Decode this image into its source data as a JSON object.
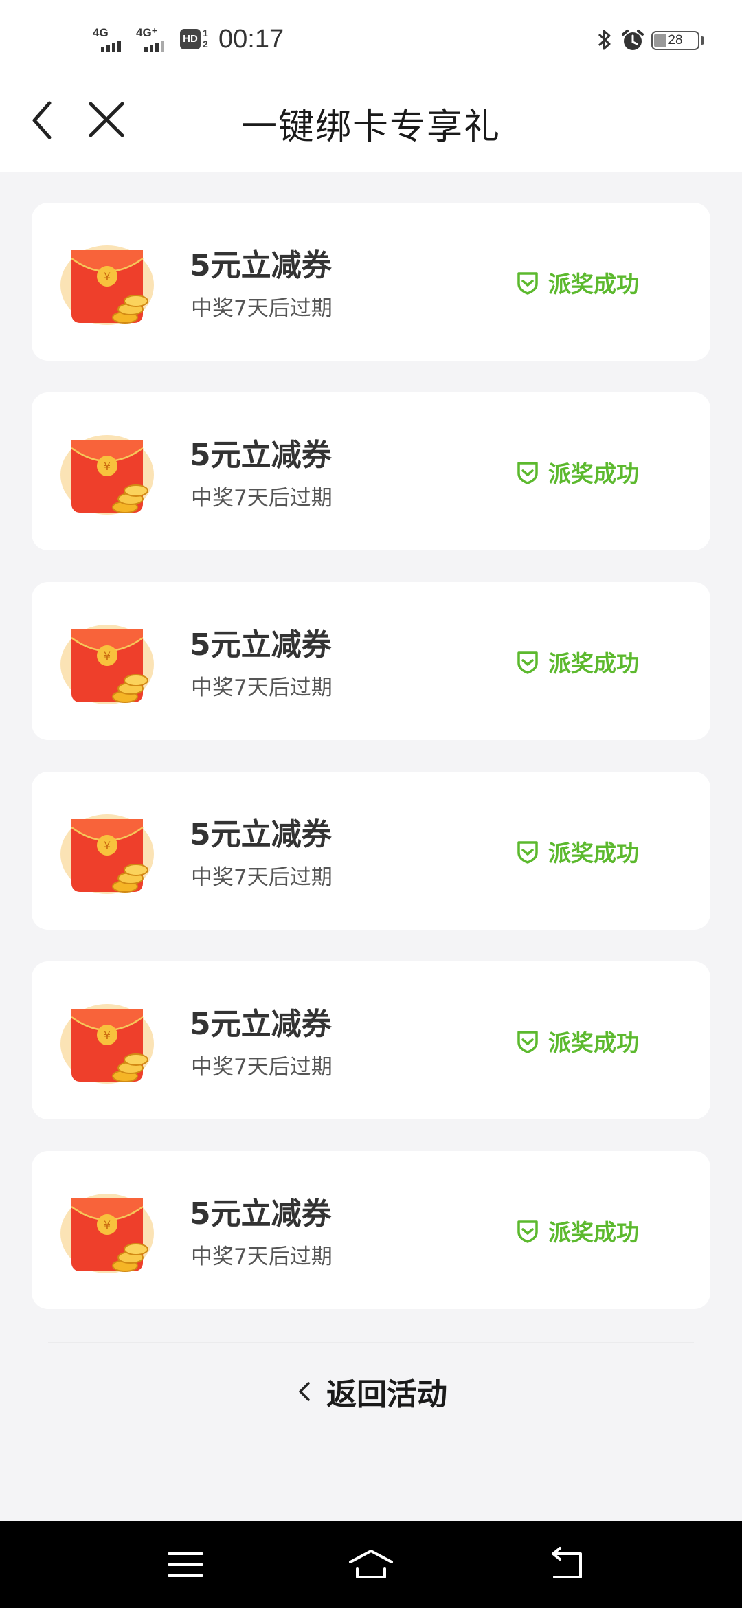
{
  "status_bar": {
    "signal_1_label": "4G",
    "signal_2_label": "4G⁺",
    "hd_label": "HD",
    "hd_sub_top": "1",
    "hd_sub_bottom": "2",
    "time": "00:17",
    "battery_level": "28"
  },
  "nav": {
    "title": "一键绑卡专享礼"
  },
  "coupons": [
    {
      "title": "5元立减券",
      "subtitle": "中奖7天后过期",
      "status": "派奖成功"
    },
    {
      "title": "5元立减券",
      "subtitle": "中奖7天后过期",
      "status": "派奖成功"
    },
    {
      "title": "5元立减券",
      "subtitle": "中奖7天后过期",
      "status": "派奖成功"
    },
    {
      "title": "5元立减券",
      "subtitle": "中奖7天后过期",
      "status": "派奖成功"
    },
    {
      "title": "5元立减券",
      "subtitle": "中奖7天后过期",
      "status": "派奖成功"
    },
    {
      "title": "5元立减券",
      "subtitle": "中奖7天后过期",
      "status": "派奖成功"
    }
  ],
  "footer": {
    "back_label": "返回活动"
  },
  "colors": {
    "success_green": "#5cb92e",
    "envelope_red": "#f0452d",
    "coin_gold": "#f5b526",
    "page_bg": "#f4f4f6"
  },
  "icons": {
    "envelope": "red-envelope-icon",
    "status": "shield-check-icon",
    "back": "chevron-left-icon",
    "close": "close-icon"
  }
}
